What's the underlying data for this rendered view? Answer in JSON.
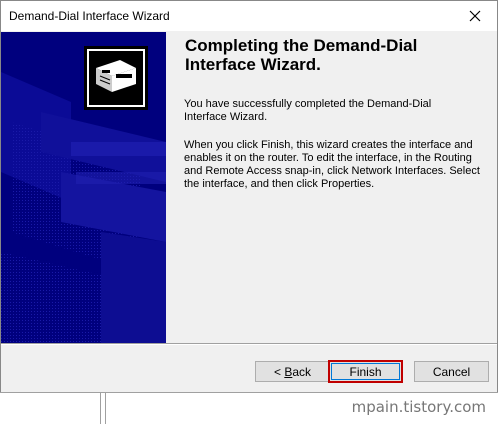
{
  "window": {
    "title": "Demand-Dial Interface Wizard",
    "close_icon": "close-icon"
  },
  "content": {
    "heading": "Completing the Demand-Dial Interface Wizard.",
    "para1": "You have successfully completed the Demand-Dial Interface Wizard.",
    "para2": "When you click Finish, this wizard creates the interface and enables it on the router. To edit the interface, in the Routing and Remote Access snap-in,  click Network Interfaces. Select the interface, and then click Properties."
  },
  "buttons": {
    "back_label_prefix": "< ",
    "back_label_accel": "B",
    "back_label_rest": "ack",
    "finish_label": "Finish",
    "cancel_label": "Cancel"
  },
  "watermark": "mpain.tistory.com"
}
